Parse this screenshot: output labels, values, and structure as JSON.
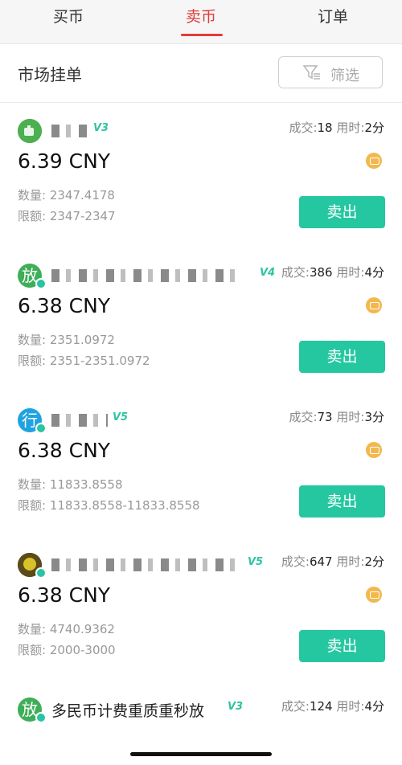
{
  "tabs": [
    {
      "label": "买币"
    },
    {
      "label": "卖币"
    },
    {
      "label": "订单"
    }
  ],
  "market": {
    "title": "市场挂单",
    "filter_label": "筛选"
  },
  "labels": {
    "deals": "成交:",
    "time": "用时:",
    "qty": "数量: ",
    "limit": "限额: ",
    "sell": "卖出"
  },
  "listings": [
    {
      "avatar_char": "",
      "avatar_color": "#4caf50",
      "level": "V3",
      "deals": "18",
      "time": "2分",
      "price": "6.39 CNY",
      "quantity": "2347.4178",
      "limit": "2347-2347"
    },
    {
      "avatar_char": "放",
      "avatar_color": "#3fae58",
      "level": "V4",
      "deals": "386",
      "time": "4分",
      "price": "6.38 CNY",
      "quantity": "2351.0972",
      "limit": "2351-2351.0972"
    },
    {
      "avatar_char": "行",
      "avatar_color": "#1fa3e0",
      "level": "V5",
      "deals": "73",
      "time": "3分",
      "price": "6.38 CNY",
      "quantity": "11833.8558",
      "limit": "11833.8558-11833.8558"
    },
    {
      "avatar_char": "",
      "avatar_color": "#6a5a20",
      "level": "V5",
      "deals": "647",
      "time": "2分",
      "price": "6.38 CNY",
      "quantity": "4740.9362",
      "limit": "2000-3000"
    }
  ],
  "partial_listing": {
    "avatar_char": "放",
    "avatar_color": "#3fae58",
    "name": "多民币计费重质重秒放",
    "level": "V3",
    "deals": "124",
    "time": "4分"
  },
  "colors": {
    "accent": "#e23b3b",
    "sell": "#25c7a1",
    "payment": "#f2b84e"
  }
}
